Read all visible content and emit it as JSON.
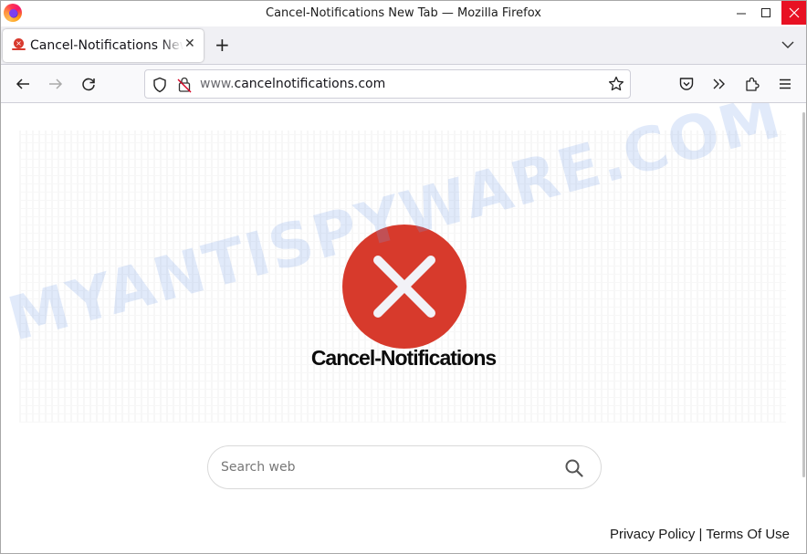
{
  "window": {
    "title": "Cancel-Notifications New Tab — Mozilla Firefox",
    "controls": {
      "minimize": "—",
      "maximize": "☐",
      "close": "✕"
    }
  },
  "tabs": [
    {
      "title": "Cancel-Notifications New Tab",
      "active": true,
      "close": "✕"
    }
  ],
  "tabstrip": {
    "new_tab": "+"
  },
  "navbar": {
    "url_prefix": "www.",
    "url_domain": "cancelnotifications.com",
    "icons": [
      "back-icon",
      "forward-icon",
      "reload-icon",
      "shield-icon",
      "insecure-lock-icon",
      "bookmark-star-icon",
      "pocket-icon",
      "overflow-chevrons-icon",
      "extensions-icon",
      "menu-icon"
    ]
  },
  "page": {
    "brand_name": "Cancel-Notifications",
    "logo_color": "#d73a2c",
    "search": {
      "placeholder": "Search web",
      "value": ""
    },
    "footer": {
      "privacy": "Privacy Policy",
      "separator": "|",
      "terms": "Terms Of Use"
    },
    "watermark": "MYANTISPYWARE.COM"
  }
}
